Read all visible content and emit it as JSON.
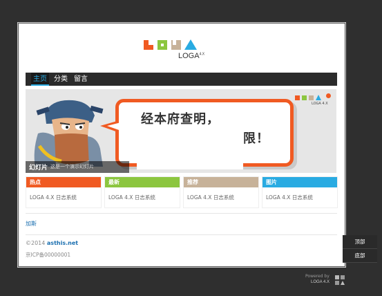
{
  "logo": {
    "text": "LOGA",
    "version": "4.X"
  },
  "nav": {
    "items": [
      {
        "label": "主页",
        "active": true
      },
      {
        "label": "分类",
        "active": false
      },
      {
        "label": "留言",
        "active": false
      }
    ]
  },
  "banner": {
    "line1": "经本府查明，",
    "line2": "限！",
    "caption_title": "幻灯片",
    "caption_desc": "这是一个演示幻灯片",
    "logo_text": "LOGA 4.X"
  },
  "boxes": [
    {
      "title": "热点",
      "text": "LOGA 4.X 日志系统",
      "color": "#f05a22"
    },
    {
      "title": "最新",
      "text": "LOGA 4.X 日志系统",
      "color": "#8cc63f"
    },
    {
      "title": "推荐",
      "text": "LOGA 4.X 日志系统",
      "color": "#c7b299"
    },
    {
      "title": "图片",
      "text": "LOGA 4.X 日志系统",
      "color": "#29abe2"
    }
  ],
  "footer": {
    "author": "加斯",
    "copyright_prefix": "©2014",
    "site": "asthis.net",
    "icp": "京ICP备00000001"
  },
  "side_buttons": {
    "top": "顶部",
    "bottom": "底部"
  },
  "powered": {
    "text": "Powered by",
    "name": "LOGA 4.X"
  }
}
